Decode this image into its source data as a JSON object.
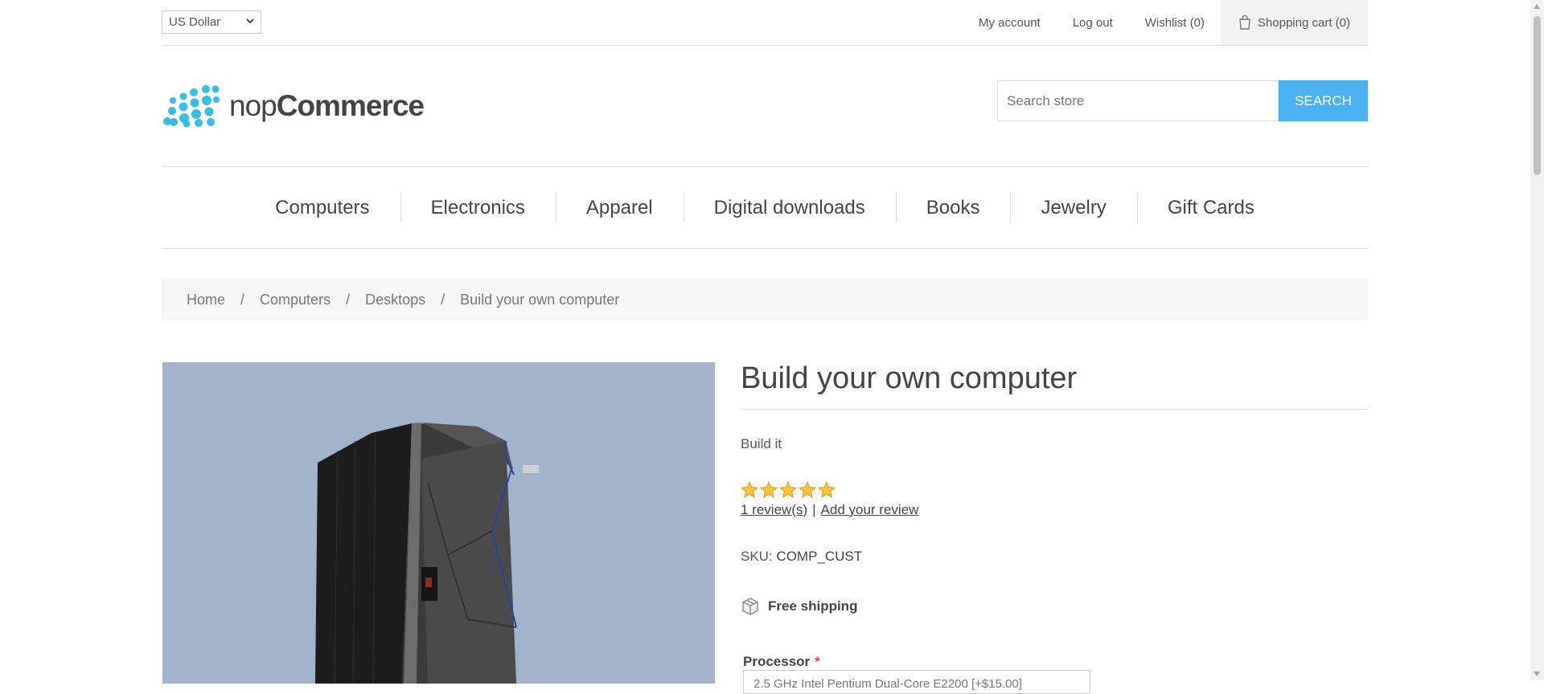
{
  "header": {
    "currency": "US Dollar",
    "links": {
      "my_account": "My account",
      "log_out": "Log out",
      "wishlist": "Wishlist (0)",
      "cart": "Shopping cart (0)"
    }
  },
  "logo": {
    "text_light": "nop",
    "text_bold": "Commerce",
    "color": "#36bfe0"
  },
  "search": {
    "placeholder": "Search store",
    "button": "SEARCH",
    "button_color": "#4ab2f1"
  },
  "menu": {
    "items": [
      "Computers",
      "Electronics",
      "Apparel",
      "Digital downloads",
      "Books",
      "Jewelry",
      "Gift Cards"
    ]
  },
  "breadcrumb": {
    "items": [
      "Home",
      "Computers",
      "Desktops",
      "Build your own computer"
    ],
    "separator": "/"
  },
  "product": {
    "title": "Build your own computer",
    "short_description": "Build it",
    "rating": 5,
    "rating_max": 5,
    "reviews_link": "1 review(s)",
    "add_review_link": "Add your review",
    "sku_label": "SKU:",
    "sku_value": "COMP_CUST",
    "shipping": "Free shipping",
    "attribute_label": "Processor",
    "attribute_required": "*",
    "attribute_value": "2.5 GHz Intel Pentium Dual-Core E2200 [+$15.00]",
    "image_alt": "IBM server cabinet",
    "image_background": "#a2b4cb"
  }
}
